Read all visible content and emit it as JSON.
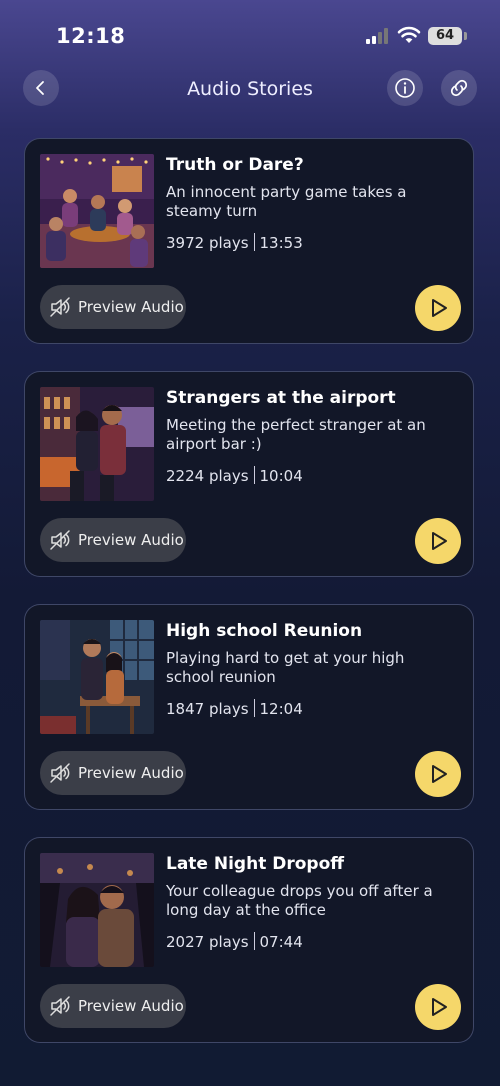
{
  "status_bar": {
    "time": "12:18",
    "battery": "64"
  },
  "header": {
    "title": "Audio Stories"
  },
  "stories": [
    {
      "title": "Truth or Dare?",
      "description": "An innocent party game takes a steamy turn",
      "plays": "3972 plays",
      "duration": "13:53",
      "preview_label": "Preview Audio"
    },
    {
      "title": "Strangers at the airport",
      "description": "Meeting the perfect stranger at an airport bar :)",
      "plays": "2224 plays",
      "duration": "10:04",
      "preview_label": "Preview Audio"
    },
    {
      "title": "High school Reunion",
      "description": "Playing hard to get at your high school reunion",
      "plays": "1847 plays",
      "duration": "12:04",
      "preview_label": "Preview Audio"
    },
    {
      "title": "Late Night Dropoff",
      "description": "Your colleague drops you off after a long day at the office",
      "plays": "2027 plays",
      "duration": "07:44",
      "preview_label": "Preview Audio"
    }
  ],
  "colors": {
    "play_button": "#f5d76a",
    "card_bg": "#121728",
    "preview_bg": "#3b3e48"
  },
  "icons": {
    "back": "chevron-left-icon",
    "info": "info-icon",
    "link": "link-icon",
    "mute": "speaker-muted-icon",
    "play": "play-icon"
  }
}
